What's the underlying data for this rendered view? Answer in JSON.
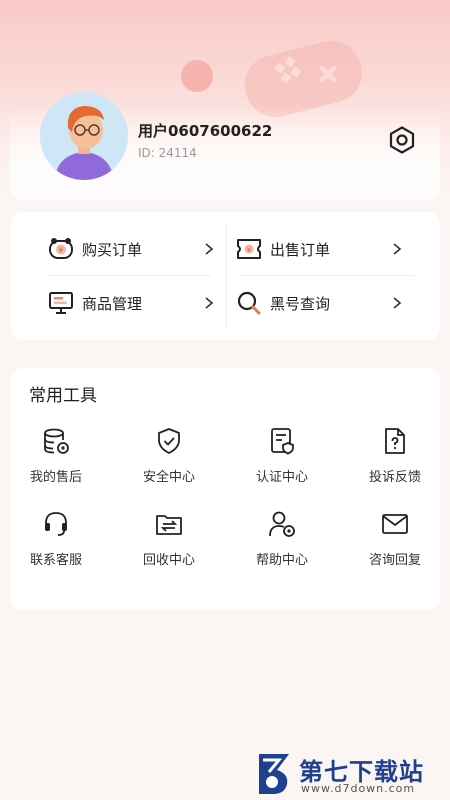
{
  "colors": {
    "accent_pink": "#f8c9c6",
    "card_bg": "#ffffff",
    "text_primary": "#222222",
    "text_secondary": "#9a9a9a",
    "watermark_blue": "#1f3f8f"
  },
  "profile": {
    "username": "用户0607600622",
    "user_id": "ID: 24114",
    "avatar_icon": "avatar-icon",
    "settings_icon": "settings-hexagon-icon"
  },
  "orders": [
    {
      "label": "购买订单",
      "icon": "buy-order-icon"
    },
    {
      "label": "出售订单",
      "icon": "sell-order-icon"
    },
    {
      "label": "商品管理",
      "icon": "product-manage-icon"
    },
    {
      "label": "黑号查询",
      "icon": "search-icon"
    }
  ],
  "tools": {
    "title": "常用工具",
    "items": [
      {
        "label": "我的售后",
        "icon": "after-sales-icon"
      },
      {
        "label": "安全中心",
        "icon": "shield-icon"
      },
      {
        "label": "认证中心",
        "icon": "certificate-icon"
      },
      {
        "label": "投诉反馈",
        "icon": "complaint-icon"
      },
      {
        "label": "联系客服",
        "icon": "headset-icon"
      },
      {
        "label": "回收中心",
        "icon": "recycle-icon"
      },
      {
        "label": "帮助中心",
        "icon": "help-user-icon"
      },
      {
        "label": "咨询回复",
        "icon": "mail-icon"
      }
    ]
  },
  "watermark": {
    "title": "第七下载站",
    "url": "www.d7down.com"
  }
}
